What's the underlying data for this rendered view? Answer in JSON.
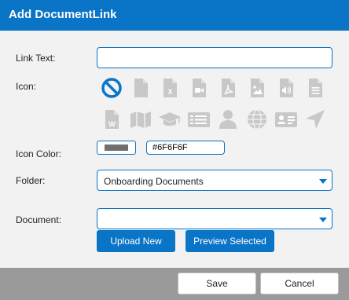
{
  "dialog": {
    "title": "Add DocumentLink"
  },
  "form": {
    "link_text_label": "Link Text:",
    "link_text_value": "",
    "icon_label": "Icon:",
    "icon_color_label": "Icon Color:",
    "icon_color_value": "#6F6F6F",
    "folder_label": "Folder:",
    "folder_value": "Onboarding Documents",
    "document_label": "Document:",
    "document_value": ""
  },
  "icons": [
    "no-icon",
    "file-icon",
    "excel-file-icon",
    "video-file-icon",
    "pdf-file-icon",
    "image-file-icon",
    "audio-file-icon",
    "text-file-icon",
    "word-file-icon",
    "map-icon",
    "graduation-cap-icon",
    "list-card-icon",
    "user-icon",
    "globe-icon",
    "id-card-icon",
    "location-arrow-icon"
  ],
  "colors": {
    "accent": "#0a74c7",
    "icon_gray": "#c8c8c8",
    "footer": "#9a9a9a",
    "selected_icon": "#0a74c7"
  },
  "buttons": {
    "upload_new": "Upload New",
    "preview_selected": "Preview Selected",
    "save": "Save",
    "cancel": "Cancel"
  }
}
